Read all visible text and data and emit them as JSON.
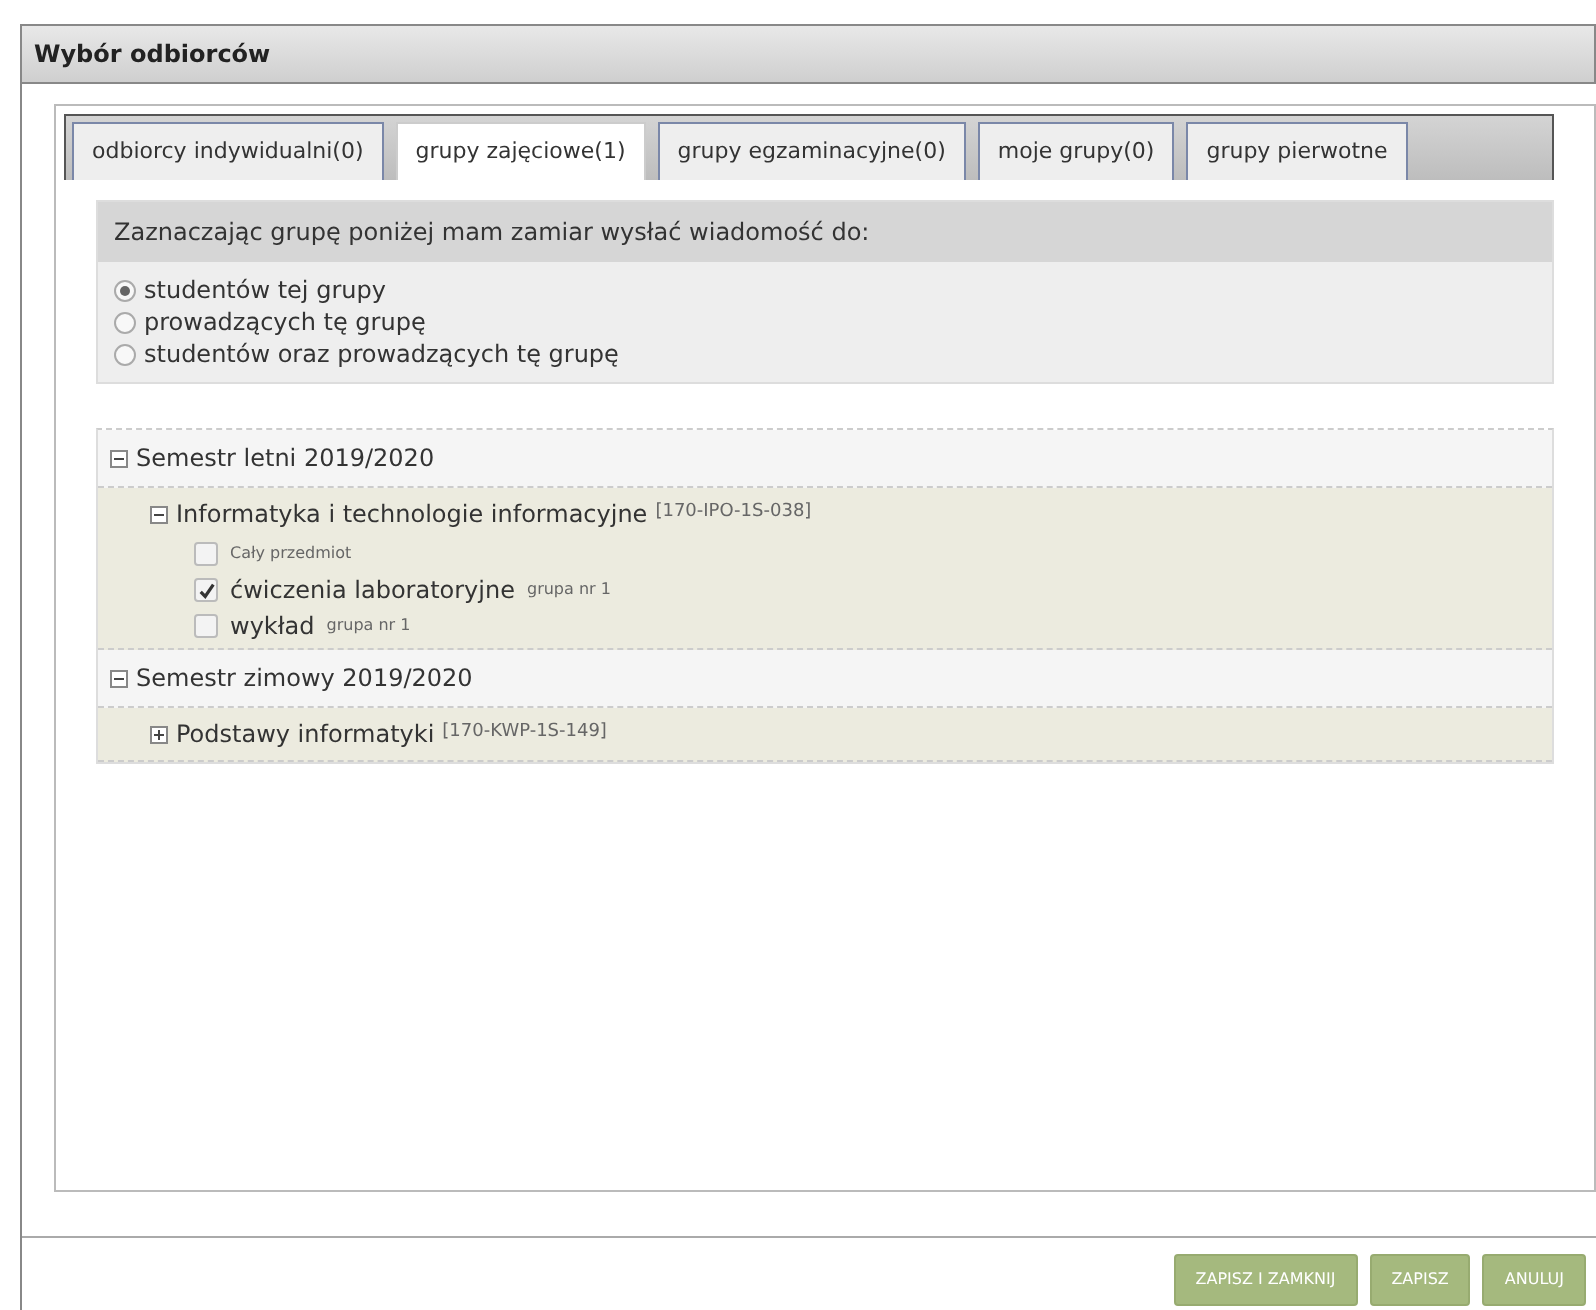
{
  "window": {
    "title": "Wybór odbiorców"
  },
  "tabs": [
    {
      "label": "odbiorcy indywidualni(0)",
      "selected": false
    },
    {
      "label": "grupy zajęciowe(1)",
      "selected": true
    },
    {
      "label": "grupy egzaminacyjne(0)",
      "selected": false
    },
    {
      "label": "moje grupy(0)",
      "selected": false
    },
    {
      "label": "grupy pierwotne",
      "selected": false
    }
  ],
  "recipients": {
    "heading": "Zaznaczając grupę poniżej mam zamiar wysłać wiadomość do:",
    "options": [
      {
        "label": "studentów tej grupy",
        "selected": true
      },
      {
        "label": "prowadzących tę grupę",
        "selected": false
      },
      {
        "label": "studentów oraz prowadzących tę grupę",
        "selected": false
      }
    ]
  },
  "tree": [
    {
      "label": "Semestr letni 2019/2020",
      "expanded": true,
      "children": [
        {
          "label": "Informatyka i technologie informacyjne",
          "code": "[170-IPO-1S-038]",
          "expanded": true,
          "children": [
            {
              "kind": "whole",
              "label": "Cały przedmiot",
              "checked": false
            },
            {
              "kind": "group",
              "label": "ćwiczenia laboratoryjne",
              "suffix": "grupa nr 1",
              "checked": true
            },
            {
              "kind": "group",
              "label": "wykład",
              "suffix": "grupa nr 1",
              "checked": false
            }
          ]
        }
      ]
    },
    {
      "label": "Semestr zimowy 2019/2020",
      "expanded": true,
      "children": [
        {
          "label": "Podstawy informatyki",
          "code": "[170-KWP-1S-149]",
          "expanded": false
        }
      ]
    }
  ],
  "buttons": [
    "ZAPISZ I ZAMKNIJ",
    "ZAPISZ",
    "ANULUJ"
  ]
}
